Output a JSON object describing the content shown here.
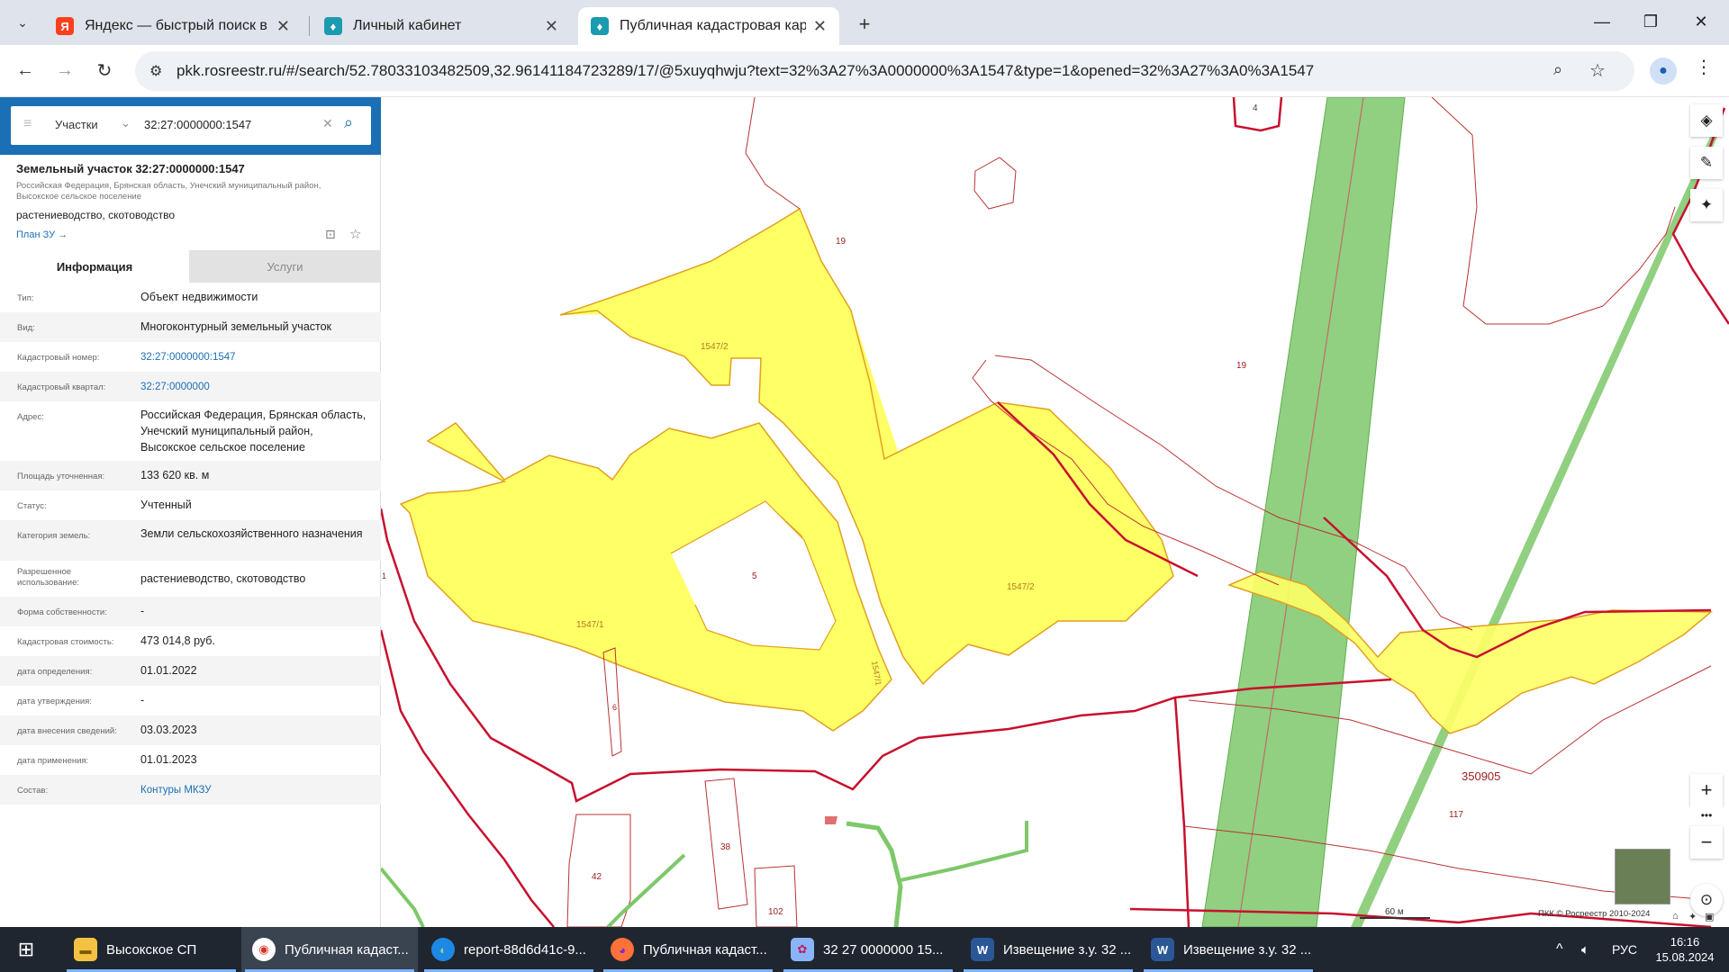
{
  "browser": {
    "tabs": [
      {
        "label": "Яндекс — быстрый поиск в ин",
        "icon": "yandex-icon"
      },
      {
        "label": "Личный кабинет",
        "icon": "rosreestr-icon"
      },
      {
        "label": "Публичная кадастровая карта",
        "icon": "rosreestr-icon"
      }
    ],
    "url": "pkk.rosreestr.ru/#/search/52.78033103482509,32.96141184723289/17/@5xuyqhwju?text=32%3A27%3A0000000%3A1547&type=1&opened=32%3A27%3A0%3A1547"
  },
  "search": {
    "category": "Участки",
    "query": "32:27:0000000:1547"
  },
  "parcel": {
    "title": "Земельный участок 32:27:0000000:1547",
    "address_short": "Российская Федерация, Брянская область, Унечский муниципальный район, Высокское сельское поселение",
    "use": "растениеводство, скотоводство",
    "plan_link": "План ЗУ →"
  },
  "panel_tabs": {
    "info": "Информация",
    "services": "Услуги"
  },
  "info_rows": [
    {
      "label": "Тип:",
      "value": "Объект недвижимости"
    },
    {
      "label": "Вид:",
      "value": "Многоконтурный земельный участок"
    },
    {
      "label": "Кадастровый номер:",
      "value": "32:27:0000000:1547"
    },
    {
      "label": "Кадастровый квартал:",
      "value": "32:27:0000000"
    },
    {
      "label": "Адрес:",
      "value": "Российская Федерация, Брянская область, Унечский муниципальный район, Высокское сельское поселение"
    },
    {
      "label": "Площадь уточненная:",
      "value": "133 620 кв. м"
    },
    {
      "label": "Статус:",
      "value": "Учтенный"
    },
    {
      "label": "Категория земель:",
      "value": "Земли сельскохозяйственного назначения"
    },
    {
      "label": "Разрешенное использование:",
      "value": "растениеводство, скотоводство"
    },
    {
      "label": "Форма собственности:",
      "value": "-"
    },
    {
      "label": "Кадастровая стоимость:",
      "value": "473 014,8 руб."
    },
    {
      "label": "дата определения:",
      "value": "01.01.2022"
    },
    {
      "label": "дата утверждения:",
      "value": "-"
    },
    {
      "label": "дата внесения сведений:",
      "value": "03.03.2023"
    },
    {
      "label": "дата применения:",
      "value": "01.01.2023"
    },
    {
      "label": "Состав:",
      "value": "Контуры МКЗУ"
    }
  ],
  "map": {
    "labels": {
      "l4": "4",
      "l19a": "19",
      "l19b": "19",
      "c1547_2a": "1547/2",
      "c1547_2b": "1547/2",
      "c1547_1": "1547/1",
      "c1547_1b": "1547/1",
      "l5": "5",
      "l6": "6",
      "l1": "1",
      "l38": "38",
      "l42": "42",
      "l102": "102",
      "l117": "117",
      "quarter": "350905"
    },
    "scale": "60 м",
    "copyright": "ПКК © Росреестр 2010-2024",
    "colors": {
      "parcel_fill": "#ffff66",
      "parcel_stroke": "#e0a020",
      "boundary": "#c8102e",
      "road": "#7dc86a"
    }
  },
  "taskbar": {
    "items": [
      {
        "label": "Высокское СП",
        "icon": "folder-icon"
      },
      {
        "label": "Публичная кадаст...",
        "icon": "chrome-icon"
      },
      {
        "label": "report-88d6d41c-9...",
        "icon": "edge-icon"
      },
      {
        "label": "Публичная кадаст...",
        "icon": "firefox-icon"
      },
      {
        "label": "32  27  0000000  15...",
        "icon": "paint-icon"
      },
      {
        "label": "Извещение з.у. 32 ...",
        "icon": "word-icon"
      },
      {
        "label": "Извещение з.у. 32 ...",
        "icon": "word-icon"
      }
    ],
    "lang": "РУС",
    "time": "16:16",
    "date": "15.08.2024"
  }
}
